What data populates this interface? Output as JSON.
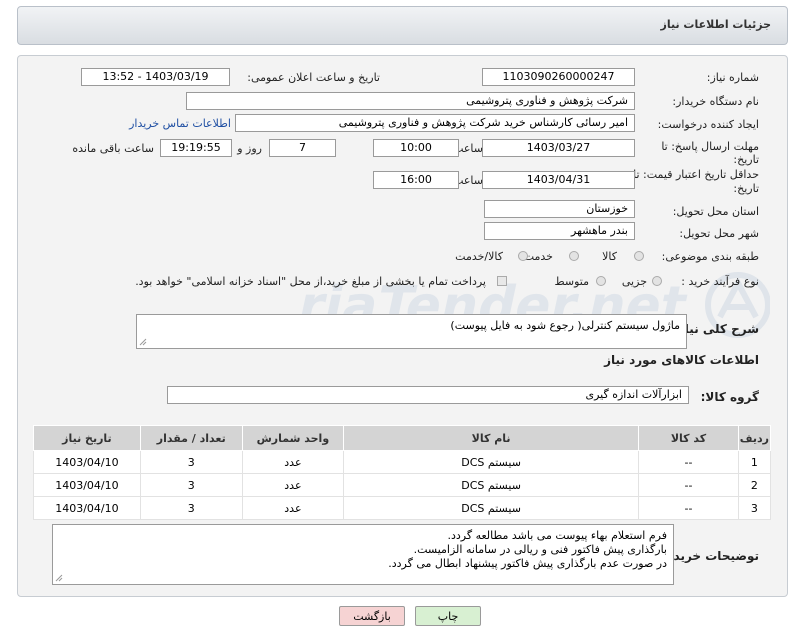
{
  "header": {
    "title": "جزئیات اطلاعات نیاز"
  },
  "form": {
    "need_number_label": "شماره نیاز:",
    "need_number": "1103090260000247",
    "announce_label": "تاریخ و ساعت اعلان عمومی:",
    "announce_value": "1403/03/19 - 13:52",
    "buyer_org_label": "نام دستگاه خریدار:",
    "buyer_org": "شرکت پژوهش و فناوری پتروشیمی",
    "creator_label": "ایجاد کننده درخواست:",
    "creator": "امیر رسائی کارشناس خرید شرکت پژوهش و فناوری پتروشیمی",
    "contact_link": "اطلاعات تماس خریدار",
    "reply_deadline_label_1": "مهلت ارسال پاسخ: تا",
    "reply_deadline_label_2": "تاریخ:",
    "reply_date": "1403/03/27",
    "hour_label": "ساعت",
    "reply_time": "10:00",
    "days_value": "7",
    "days_label": "روز و",
    "remaining_time": "19:19:55",
    "remaining_label": "ساعت باقی مانده",
    "validity_label_1": "حداقل تاریخ اعتبار قیمت: تا",
    "validity_label_2": "تاریخ:",
    "validity_date": "1403/04/31",
    "validity_time": "16:00",
    "province_label": "استان محل تحویل:",
    "province": "خوزستان",
    "city_label": "شهر محل تحویل:",
    "city": "بندر ماهشهر",
    "category_label": "طبقه بندی موضوعی:",
    "category_options": [
      "کالا",
      "خدمت",
      "کالا/خدمت"
    ],
    "purchase_type_label": "نوع فرآیند خرید :",
    "purchase_options": [
      "جزیی",
      "متوسط"
    ],
    "payment_note": "پرداخت تمام یا بخشی از مبلغ خرید،از محل \"اسناد خزانه اسلامی\" خواهد بود."
  },
  "description": {
    "label": "شرح کلی نیاز:",
    "value": "ماژول سیستم کنترلی( رجوع شود به فایل پیوست)"
  },
  "goods": {
    "section_title": "اطلاعات کالاهای مورد نیاز",
    "group_label": "گروه کالا:",
    "group_value": "ابزارآلات اندازه گیری",
    "columns": [
      "ردیف",
      "کد کالا",
      "نام کالا",
      "واحد شمارش",
      "تعداد / مقدار",
      "تاریخ نیاز"
    ],
    "rows": [
      [
        "1",
        "--",
        "سیستم DCS",
        "عدد",
        "3",
        "1403/04/10"
      ],
      [
        "2",
        "--",
        "سیستم DCS",
        "عدد",
        "3",
        "1403/04/10"
      ],
      [
        "3",
        "--",
        "سیستم DCS",
        "عدد",
        "3",
        "1403/04/10"
      ]
    ]
  },
  "buyer_notes": {
    "label": "توضیحات خریدار:",
    "lines": [
      "فرم استعلام بهاء پیوست می باشد مطالعه گردد.",
      "بارگذاری پیش فاکتور فنی و ریالی در سامانه الزامیست.",
      "در صورت عدم بارگذاری پیش فاکتور پیشنهاد ابطال می گردد."
    ]
  },
  "buttons": {
    "print": "چاپ",
    "back": "بازگشت"
  },
  "watermark": {
    "text": "AriaTender.net",
    "color": "#d7dde3"
  },
  "colors": {
    "link": "#1f4fa3",
    "back_button_bg": "#f6d3d3",
    "print_button_bg": "#d8f0d2",
    "table_header_bg": "#d4d4d4"
  }
}
